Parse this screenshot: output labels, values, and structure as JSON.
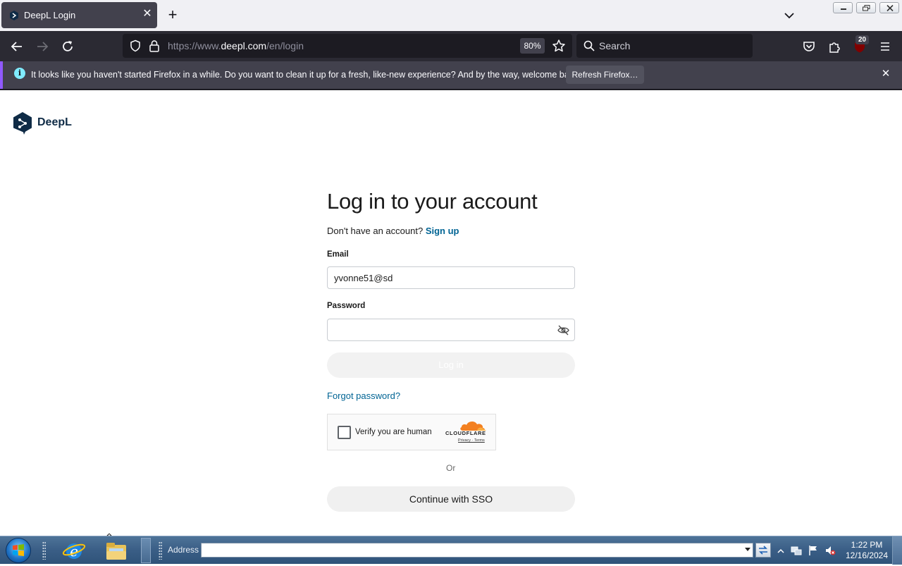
{
  "browser": {
    "tab": {
      "title": "DeepL Login"
    },
    "url_prefix": "https://www.",
    "url_host": "deepl.com",
    "url_path": "/en/login",
    "zoom": "80%",
    "search_placeholder": "Search",
    "extension_badge": "20"
  },
  "notification": {
    "message": "It looks like you haven't started Firefox in a while. Do you want to clean it up for a fresh, like-new experience? And by the way, welcome back!",
    "button_label": "Refresh Firefox…"
  },
  "page": {
    "logo_text": "DeepL",
    "title": "Log in to your account",
    "signup_prompt": "Don't have an account?",
    "signup_link": "Sign up",
    "email_label": "Email",
    "email_value": "yvonne51@sd",
    "password_label": "Password",
    "password_value": "",
    "login_button": "Log in",
    "forgot_password": "Forgot password?",
    "captcha": {
      "label": "Verify you are human",
      "brand": "CLOUDFLARE",
      "links": "Privacy · Terms"
    },
    "or_text": "Or",
    "sso_button": "Continue with SSO"
  },
  "taskbar": {
    "address_label": "Address",
    "address_value": "",
    "time": "1:22 PM",
    "date": "12/16/2024"
  },
  "colors": {
    "firefox_dark": "#2b2a33",
    "link_blue": "#006494",
    "deepl_navy": "#0f2b46",
    "cloudflare_orange": "#f38020"
  }
}
